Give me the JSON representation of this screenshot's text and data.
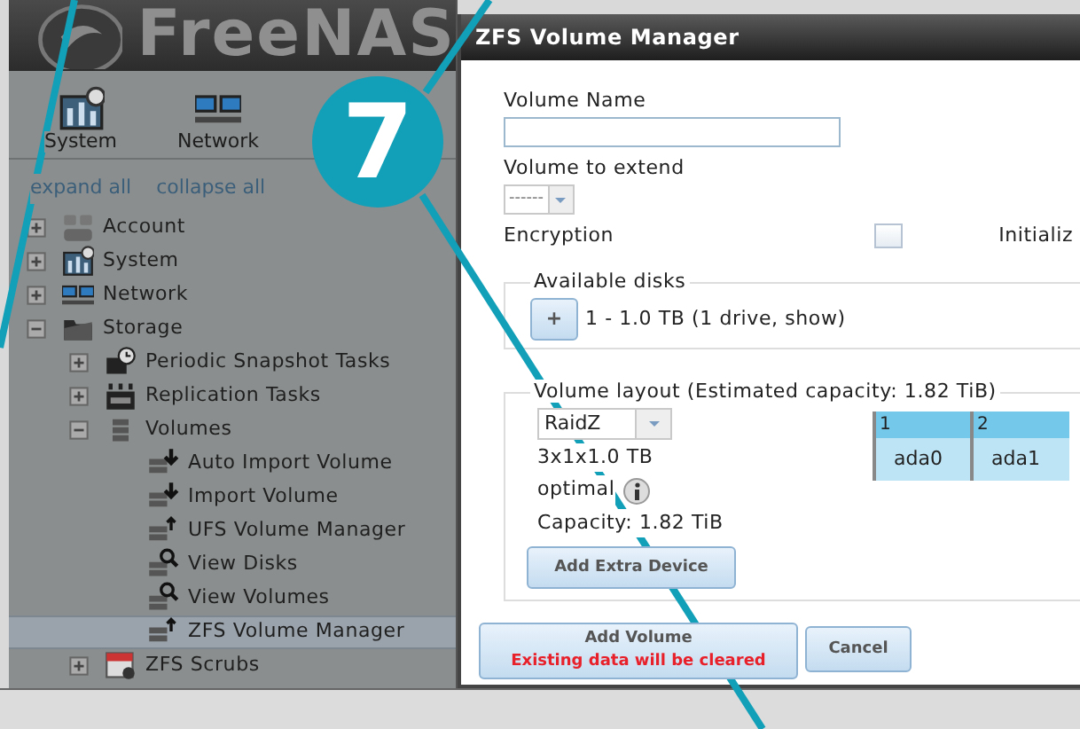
{
  "header": {
    "logo": "FreeNAS"
  },
  "toolbar": [
    {
      "label": "System",
      "kind": "system"
    },
    {
      "label": "Network",
      "kind": "network"
    }
  ],
  "tree_links": [
    "expand all",
    "collapse all"
  ],
  "tree": [
    {
      "label": "Account",
      "kind": "account",
      "expanded": false,
      "selected": false
    },
    {
      "label": "System",
      "kind": "system",
      "expanded": false,
      "selected": false
    },
    {
      "label": "Network",
      "kind": "network",
      "expanded": false,
      "selected": false
    },
    {
      "label": "Storage",
      "kind": "folder",
      "expanded": true,
      "selected": false,
      "children": [
        {
          "label": "Periodic Snapshot Tasks",
          "kind": "snapshot",
          "expanded": false,
          "selected": false
        },
        {
          "label": "Replication Tasks",
          "kind": "replication",
          "expanded": false,
          "selected": false
        },
        {
          "label": "Volumes",
          "kind": "volumes",
          "expanded": true,
          "selected": false,
          "children": [
            {
              "label": "Auto Import Volume",
              "kind": "import",
              "selected": false
            },
            {
              "label": "Import Volume",
              "kind": "import",
              "selected": false
            },
            {
              "label": "UFS Volume Manager",
              "kind": "manager",
              "selected": false
            },
            {
              "label": "View Disks",
              "kind": "view",
              "selected": false
            },
            {
              "label": "View Volumes",
              "kind": "view",
              "selected": false
            },
            {
              "label": "ZFS Volume Manager",
              "kind": "manager",
              "selected": true
            }
          ]
        },
        {
          "label": "ZFS Scrubs",
          "kind": "calendar",
          "expanded": false,
          "selected": false
        }
      ]
    }
  ],
  "dialog": {
    "title": "ZFS Volume Manager",
    "volume_name": {
      "label": "Volume Name"
    },
    "volume_to_extend": {
      "label": "Volume to extend",
      "value": "------"
    },
    "encryption": {
      "label": "Encryption",
      "checked": false
    },
    "initialize": {
      "label": "Initializ"
    },
    "available_disks": {
      "legend": "Available disks",
      "button": "+",
      "text": "1 - 1.0 TB (1 drive, show)"
    },
    "volume_layout": {
      "legend": "Volume layout (Estimated capacity: 1.82 TiB)",
      "layout": "RaidZ",
      "size": "3x1x1.0 TB",
      "status": "optimal",
      "capacity": "Capacity: 1.82 TiB",
      "add_button": "Add Extra Device",
      "grid": {
        "columns": [
          "1",
          "2"
        ],
        "row": [
          "ada0",
          "ada1"
        ]
      }
    },
    "buttons": [
      {
        "kind": "primary",
        "label": "Add Volume",
        "warning": "Existing data will be cleared"
      },
      {
        "kind": "plain",
        "label": "Cancel"
      }
    ]
  },
  "callout": {
    "number": "7"
  }
}
